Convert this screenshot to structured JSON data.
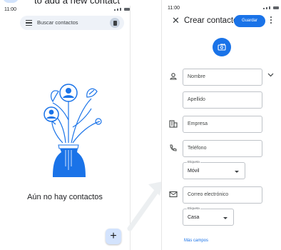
{
  "caption": "to add a new contact",
  "left_phone": {
    "time": "11:00",
    "search_placeholder": "Buscar contactos",
    "empty_message": "Aún no hay contactos",
    "fab_label": "+"
  },
  "right_phone": {
    "time": "11:00",
    "close_label": "✕",
    "title": "Crear contacto",
    "save_label": "Guardar",
    "fields": {
      "first_name": "Nombre",
      "last_name": "Apellido",
      "company": "Empresa",
      "phone": "Teléfono",
      "phone_label_caption": "Etiqueta",
      "phone_label_value": "Móvil",
      "email": "Correo electrónico",
      "email_label_caption": "Etiqueta",
      "email_label_value": "Casa"
    },
    "more_fields": "Más campos"
  },
  "colors": {
    "accent": "#1a73e8",
    "fab_bg": "#d3e3fd",
    "search_bg": "#eef2f8"
  }
}
